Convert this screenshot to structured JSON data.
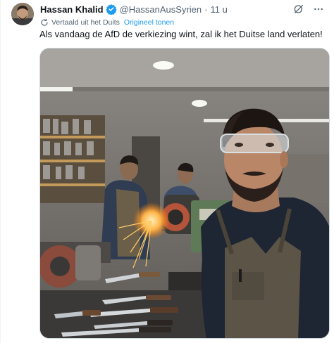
{
  "tweet": {
    "author_name": "Hassan Khalid",
    "handle": "@HassanAusSyrien",
    "separator": "·",
    "time": "11 u",
    "translation_label": "Vertaald uit het Duits",
    "show_original_label": "Origineel tonen",
    "text": "Als vandaag de AfD de verkiezing wint, zal ik het Duitse land verlaten!"
  },
  "icons": {
    "verified": "verified-badge-icon",
    "grok": "grok-icon",
    "more": "more-icon",
    "translate": "translate-icon"
  },
  "colors": {
    "accent": "#1d9bf0",
    "text_primary": "#0f1419",
    "text_secondary": "#536471",
    "border": "#cfd9de"
  }
}
